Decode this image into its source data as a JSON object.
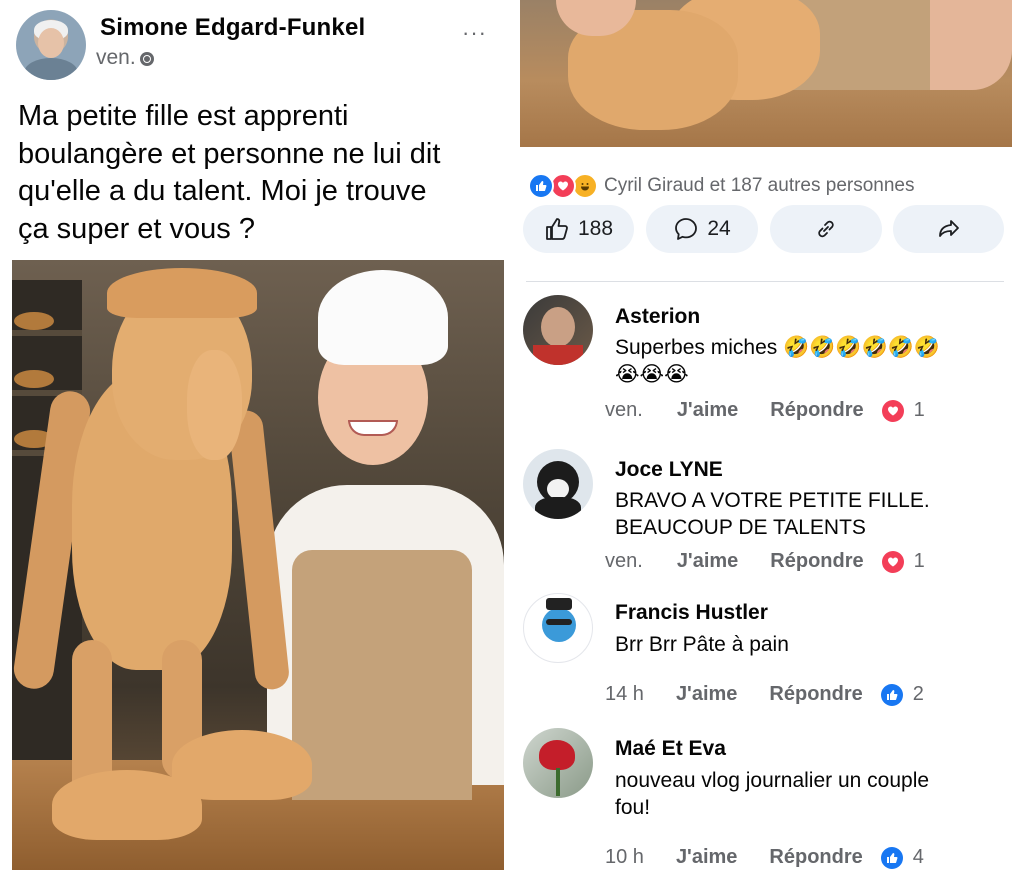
{
  "post": {
    "author": "Simone Edgard-Funkel",
    "time": "ven.",
    "more": "···",
    "text_lines": [
      "Ma petite fille est apprenti",
      "boulangère et personne ne lui dit",
      "qu'elle a du talent. Moi je trouve",
      "ça super et vous ?"
    ]
  },
  "reactions": {
    "icons": [
      "like-icon",
      "love-icon",
      "haha-icon"
    ],
    "summary": "Cyril Giraud et 187 autres personnes"
  },
  "actions": {
    "like_count": "188",
    "comment_count": "24"
  },
  "comments": [
    {
      "name": "Asterion",
      "text_line1": "Superbes miches 🤣🤣🤣🤣🤣🤣",
      "text_line2": "😭😭😭",
      "time": "ven.",
      "like": "J'aime",
      "reply": "Répondre",
      "reaction": "love",
      "count": "1"
    },
    {
      "name": "Joce LYNE",
      "text_line1": "BRAVO A VOTRE PETITE FILLE.",
      "text_line2": "BEAUCOUP DE TALENTS",
      "time": "ven.",
      "like": "J'aime",
      "reply": "Répondre",
      "reaction": "love",
      "count": "1"
    },
    {
      "name": "Francis Hustler",
      "text_line1": "Brr Brr Pâte à pain",
      "text_line2": "",
      "time": "14 h",
      "like": "J'aime",
      "reply": "Répondre",
      "reaction": "like",
      "count": "2"
    },
    {
      "name": "Maé Et Eva",
      "text_line1": "nouveau vlog journalier un couple",
      "text_line2": "fou!",
      "time": "10 h",
      "like": "J'aime",
      "reply": "Répondre",
      "reaction": "like",
      "count": "4"
    }
  ],
  "colors": {
    "like_blue": "#1877f2",
    "love_red": "#f33e58",
    "pill_bg": "#edf2f8",
    "meta_gray": "#65676b"
  }
}
